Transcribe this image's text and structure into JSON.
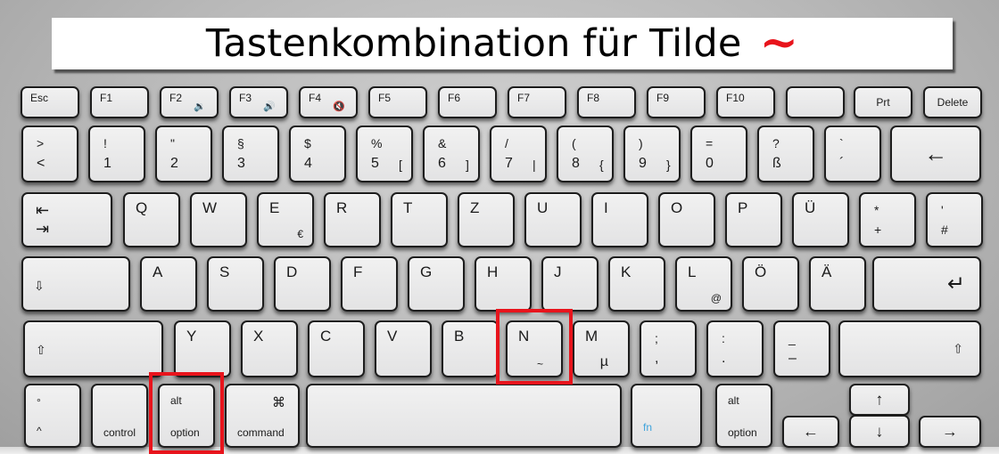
{
  "title": {
    "text": "Tastenkombination für Tilde",
    "symbol": "~",
    "symbol_color": "#e8141c"
  },
  "highlight_color": "#e8141c",
  "highlighted_keys": [
    "alt/option (left)",
    "N"
  ],
  "rows": {
    "function": [
      {
        "label": "Esc"
      },
      {
        "label": "F1"
      },
      {
        "label": "F2",
        "icon": "volume-down-icon",
        "glyph": "🔉"
      },
      {
        "label": "F3",
        "icon": "volume-up-icon",
        "glyph": "🔊"
      },
      {
        "label": "F4",
        "icon": "mute-icon",
        "glyph": "🔇"
      },
      {
        "label": "F5"
      },
      {
        "label": "F6"
      },
      {
        "label": "F7"
      },
      {
        "label": "F8"
      },
      {
        "label": "F9"
      },
      {
        "label": "F10"
      },
      {
        "label": ""
      },
      {
        "label": "Prt"
      },
      {
        "label": "Delete"
      }
    ],
    "number": [
      {
        "top": ">",
        "bottom": "<",
        "alt": ""
      },
      {
        "top": "!",
        "bottom": "1",
        "alt": ""
      },
      {
        "top": "\"",
        "bottom": "2",
        "alt": ""
      },
      {
        "top": "§",
        "bottom": "3",
        "alt": ""
      },
      {
        "top": "$",
        "bottom": "4",
        "alt": ""
      },
      {
        "top": "%",
        "bottom": "5",
        "alt": "["
      },
      {
        "top": "&",
        "bottom": "6",
        "alt": "]"
      },
      {
        "top": "/",
        "bottom": "7",
        "alt": "|"
      },
      {
        "top": "(",
        "bottom": "8",
        "alt": "{"
      },
      {
        "top": ")",
        "bottom": "9",
        "alt": "}"
      },
      {
        "top": "=",
        "bottom": "0",
        "alt": ""
      },
      {
        "top": "?",
        "bottom": "ß",
        "alt": ""
      },
      {
        "top": "`",
        "bottom": "´",
        "alt": ""
      }
    ],
    "backspace": {
      "glyph": "←"
    },
    "tab": {
      "glyph_top": "⇤",
      "glyph_bottom": "⇥"
    },
    "qwertz": [
      {
        "label": "Q",
        "alt": ""
      },
      {
        "label": "W",
        "alt": ""
      },
      {
        "label": "E",
        "alt": "€"
      },
      {
        "label": "R",
        "alt": ""
      },
      {
        "label": "T",
        "alt": ""
      },
      {
        "label": "Z",
        "alt": ""
      },
      {
        "label": "U",
        "alt": ""
      },
      {
        "label": "I",
        "alt": ""
      },
      {
        "label": "O",
        "alt": ""
      },
      {
        "label": "P",
        "alt": ""
      },
      {
        "label": "Ü",
        "alt": ""
      }
    ],
    "plus_key": {
      "top": "*",
      "bottom": "+"
    },
    "hash_key": {
      "top": "'",
      "bottom": "#"
    },
    "capslock": {
      "glyph": "⇩"
    },
    "home": [
      {
        "label": "A",
        "alt": ""
      },
      {
        "label": "S",
        "alt": ""
      },
      {
        "label": "D",
        "alt": ""
      },
      {
        "label": "F",
        "alt": ""
      },
      {
        "label": "G",
        "alt": ""
      },
      {
        "label": "H",
        "alt": ""
      },
      {
        "label": "J",
        "alt": ""
      },
      {
        "label": "K",
        "alt": ""
      },
      {
        "label": "L",
        "alt": "@"
      },
      {
        "label": "Ö",
        "alt": ""
      },
      {
        "label": "Ä",
        "alt": ""
      }
    ],
    "enter": {
      "glyph": "↵"
    },
    "shift_left": {
      "glyph": "⇧"
    },
    "bottom_letters": [
      {
        "label": "Y",
        "alt": ""
      },
      {
        "label": "X",
        "alt": ""
      },
      {
        "label": "C",
        "alt": ""
      },
      {
        "label": "V",
        "alt": ""
      },
      {
        "label": "B",
        "alt": ""
      },
      {
        "label": "N",
        "alt": "~"
      },
      {
        "label": "M",
        "alt": "µ"
      }
    ],
    "punct": [
      {
        "top": ";",
        "bottom": ","
      },
      {
        "top": ":",
        "bottom": "."
      },
      {
        "top": "_",
        "bottom": "–"
      }
    ],
    "shift_right": {
      "glyph": "⇧"
    },
    "modifiers": {
      "caret": {
        "top": "°",
        "bottom": "^"
      },
      "control": {
        "label": "control"
      },
      "option_left": {
        "top": "alt",
        "bottom": "option"
      },
      "command": {
        "symbol": "⌘",
        "label": "command"
      },
      "space": {
        "label": ""
      },
      "fn": {
        "label": "fn"
      },
      "option_right": {
        "top": "alt",
        "bottom": "option"
      }
    },
    "arrows": {
      "left": "←",
      "up": "↑",
      "down": "↓",
      "right": "→"
    }
  }
}
